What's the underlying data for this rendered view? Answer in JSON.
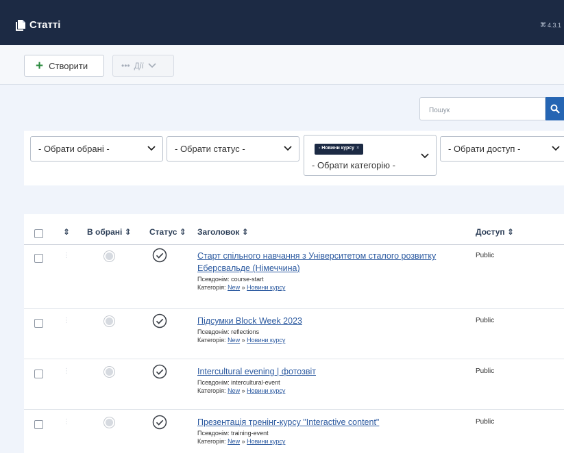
{
  "header": {
    "title": "Статті",
    "version": "4.3.1"
  },
  "toolbar": {
    "create_label": "Створити",
    "actions_label": "Дії"
  },
  "search": {
    "placeholder": "Пошук"
  },
  "filters": {
    "featured_placeholder": "- Обрати обрані -",
    "status_placeholder": "- Обрати статус -",
    "category_chip": "- Новини курсу",
    "category_placeholder": "- Обрати категорію -",
    "access_placeholder": "- Обрати доступ -"
  },
  "table": {
    "columns": {
      "featured": "В обрані",
      "status": "Статус",
      "title": "Заголовок",
      "access": "Доступ"
    },
    "sort_glyph": "⇕",
    "alias_label": "Псевдонім:",
    "category_label": "Категорія:",
    "rows": [
      {
        "title": "Старт спільного навчання з Університетом сталого розвитку Еберсвальде (Німеччина)",
        "alias": "course-start",
        "cat_parent": "New",
        "cat_sep": "»",
        "cat_child": "Новини курсу",
        "access": "Public"
      },
      {
        "title": "Підсумки Block Week 2023",
        "alias": "reflections",
        "cat_parent": "New",
        "cat_sep": "»",
        "cat_child": "Новини курсу",
        "access": "Public"
      },
      {
        "title": "Intercultural evening | фотозвіт",
        "alias": "intercultural-event",
        "cat_parent": "New",
        "cat_sep": "»",
        "cat_child": "Новини курсу",
        "access": "Public"
      },
      {
        "title": "Презентація тренінг-курсу \"Interactive content\"",
        "alias": "training-event",
        "cat_parent": "New",
        "cat_sep": "»",
        "cat_child": "Новини курсу",
        "access": "Public"
      }
    ]
  },
  "colors": {
    "header_bg": "#1c2a44",
    "accent": "#2565b3",
    "link": "#2c5aa0",
    "published_green": "#2a8a3e"
  }
}
